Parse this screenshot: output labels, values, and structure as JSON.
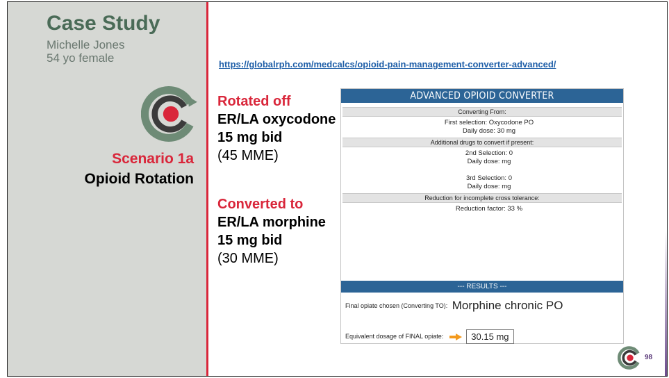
{
  "left": {
    "title": "Case Study",
    "patient_name": "Michelle Jones",
    "patient_info": "54 yo female",
    "scenario_title": "Scenario 1a",
    "scenario_subtitle": "Opioid Rotation",
    "logo_icon": "circular-c-logo-icon"
  },
  "middle": {
    "rotated_label": "Rotated off",
    "rotated_drug": "ER/LA oxycodone",
    "rotated_dose": "15 mg bid",
    "rotated_mme": "(45 MME)",
    "converted_label": "Converted to",
    "converted_drug": "ER/LA morphine",
    "converted_dose": "15 mg bid",
    "converted_mme": "(30 MME)"
  },
  "url": "https://globalrph.com/medcalcs/opioid-pain-management-converter-advanced/",
  "converter": {
    "title": "ADVANCED OPIOID CONVERTER",
    "converting_from_header": "Converting From:",
    "first_selection_label": "First selection:",
    "first_selection_value": "Oxycodone PO",
    "daily_dose_label": "Daily dose:",
    "first_daily_dose": "30",
    "dose_unit": "mg",
    "additional_header": "Additional drugs to convert if present:",
    "second_selection_label": "2nd Selection:",
    "second_selection_value": "0",
    "second_daily_dose": "",
    "third_selection_label": "3rd Selection:",
    "third_selection_value": "0",
    "third_daily_dose": "",
    "reduction_header": "Reduction for incomplete cross tolerance:",
    "reduction_label": "Reduction factor:",
    "reduction_value": "33",
    "reduction_unit": "%",
    "results_header": "--- RESULTS ---",
    "final_label": "Final opiate chosen (Converting TO):",
    "final_value": "Morphine chronic PO",
    "equiv_label": "Equivalent dosage of FINAL opiate:",
    "equiv_value": "30.15 mg"
  },
  "footer": {
    "page_number": "98"
  },
  "colors": {
    "accent_red": "#d9263a",
    "title_green": "#4a6b57",
    "panel_gray": "#d6d8d4",
    "converter_blue": "#2c6496"
  }
}
